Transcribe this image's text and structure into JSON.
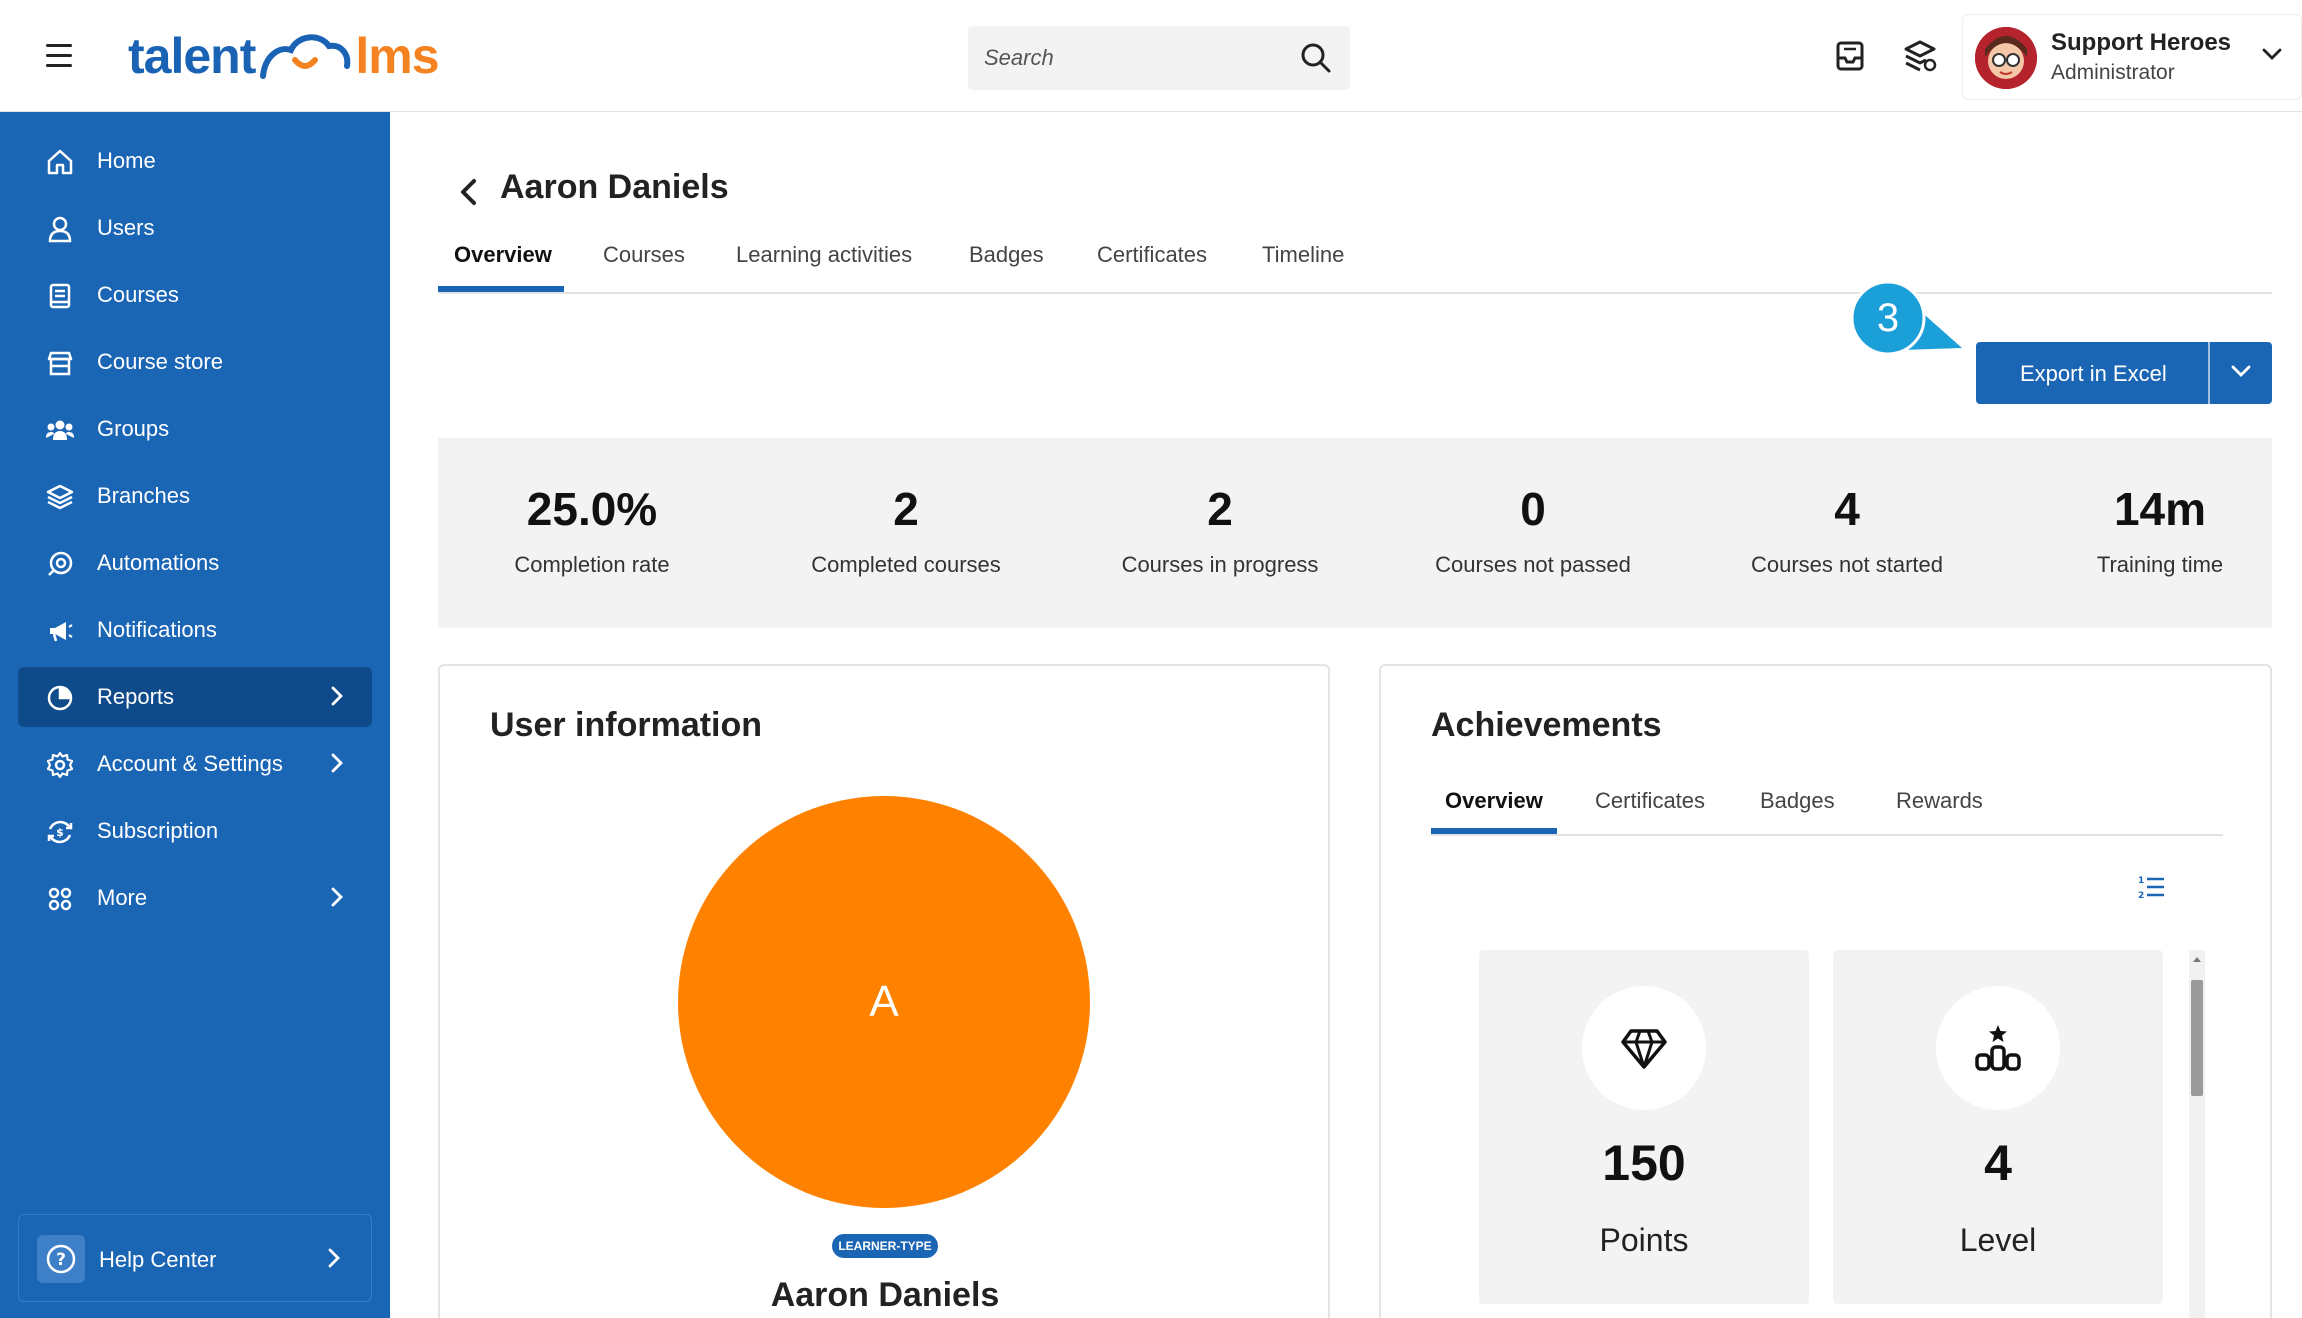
{
  "header": {
    "logo_left": "talent",
    "logo_right": "lms",
    "search_placeholder": "Search",
    "user_name": "Support Heroes",
    "user_role": "Administrator"
  },
  "sidebar": {
    "items": [
      {
        "label": "Home",
        "icon": "home-icon"
      },
      {
        "label": "Users",
        "icon": "user-icon"
      },
      {
        "label": "Courses",
        "icon": "book-icon"
      },
      {
        "label": "Course store",
        "icon": "store-icon"
      },
      {
        "label": "Groups",
        "icon": "groups-icon"
      },
      {
        "label": "Branches",
        "icon": "layers-icon"
      },
      {
        "label": "Automations",
        "icon": "automation-icon"
      },
      {
        "label": "Notifications",
        "icon": "megaphone-icon"
      },
      {
        "label": "Reports",
        "icon": "pie-chart-icon",
        "active": true
      },
      {
        "label": "Account & Settings",
        "icon": "gear-icon"
      },
      {
        "label": "Subscription",
        "icon": "subscription-icon"
      },
      {
        "label": "More",
        "icon": "grid-icon"
      }
    ],
    "help_label": "Help Center"
  },
  "page": {
    "title": "Aaron Daniels",
    "tabs": [
      "Overview",
      "Courses",
      "Learning activities",
      "Badges",
      "Certificates",
      "Timeline"
    ],
    "active_tab": "Overview",
    "step_badge": "3",
    "export_label": "Export in Excel"
  },
  "stats": [
    {
      "value": "25.0%",
      "label": "Completion rate"
    },
    {
      "value": "2",
      "label": "Completed courses"
    },
    {
      "value": "2",
      "label": "Courses in progress"
    },
    {
      "value": "0",
      "label": "Courses not passed"
    },
    {
      "value": "4",
      "label": "Courses not started"
    },
    {
      "value": "14m",
      "label": "Training time"
    }
  ],
  "user_info": {
    "title": "User information",
    "avatar_letter": "A",
    "avatar_color": "#fe8200",
    "learner_type": "LEARNER-TYPE",
    "name": "Aaron Daniels"
  },
  "achievements": {
    "title": "Achievements",
    "tabs": [
      "Overview",
      "Certificates",
      "Badges",
      "Rewards"
    ],
    "points_value": "150",
    "points_label": "Points",
    "level_value": "4",
    "level_label": "Level"
  },
  "colors": {
    "brand_blue": "#1b65b5",
    "brand_orange": "#f58220",
    "callout_cyan": "#1a9fd9"
  }
}
